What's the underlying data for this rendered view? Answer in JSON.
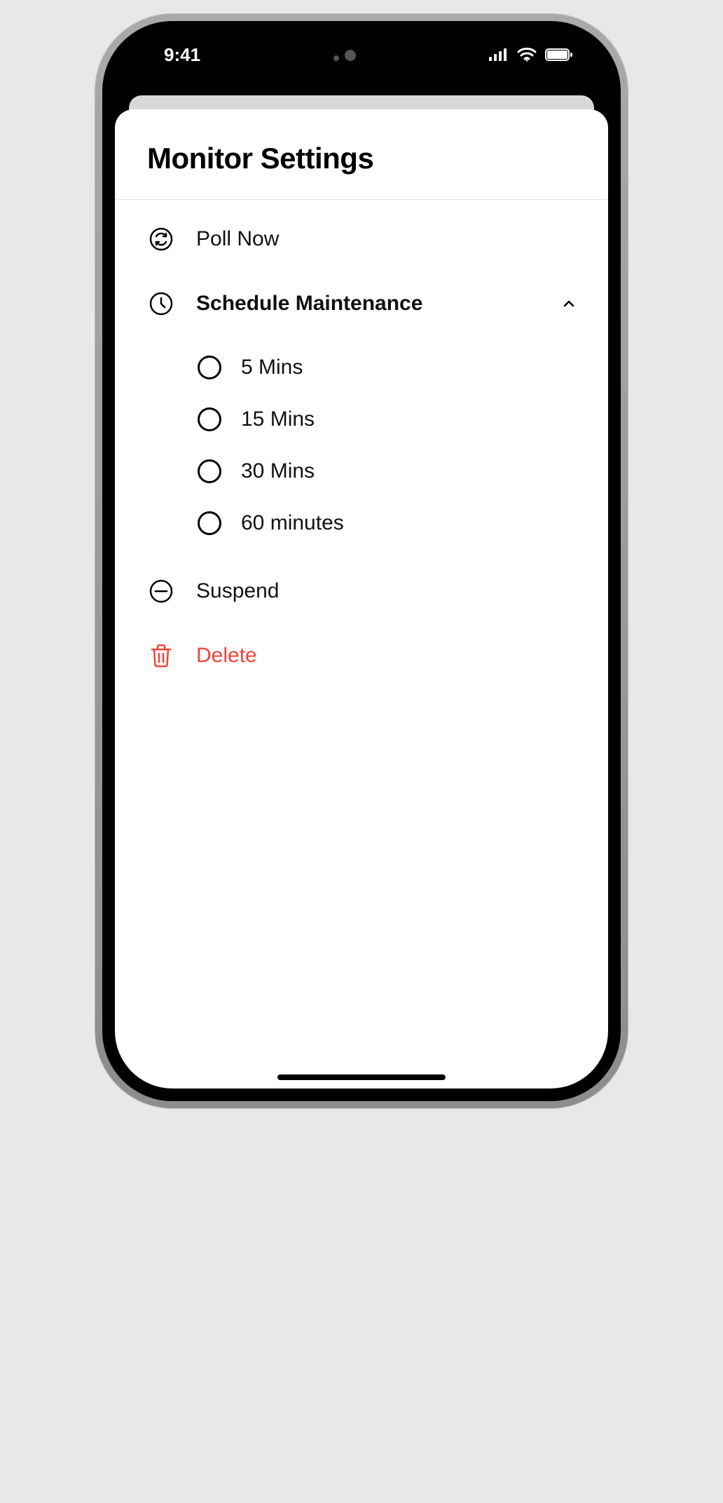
{
  "statusbar": {
    "time": "9:41"
  },
  "sheet": {
    "title": "Monitor Settings",
    "rows": {
      "poll": "Poll Now",
      "schedule": "Schedule Maintenance",
      "suspend": "Suspend",
      "delete": "Delete"
    },
    "schedule_options": [
      "5 Mins",
      "15 Mins",
      "30 Mins",
      "60 minutes"
    ]
  }
}
